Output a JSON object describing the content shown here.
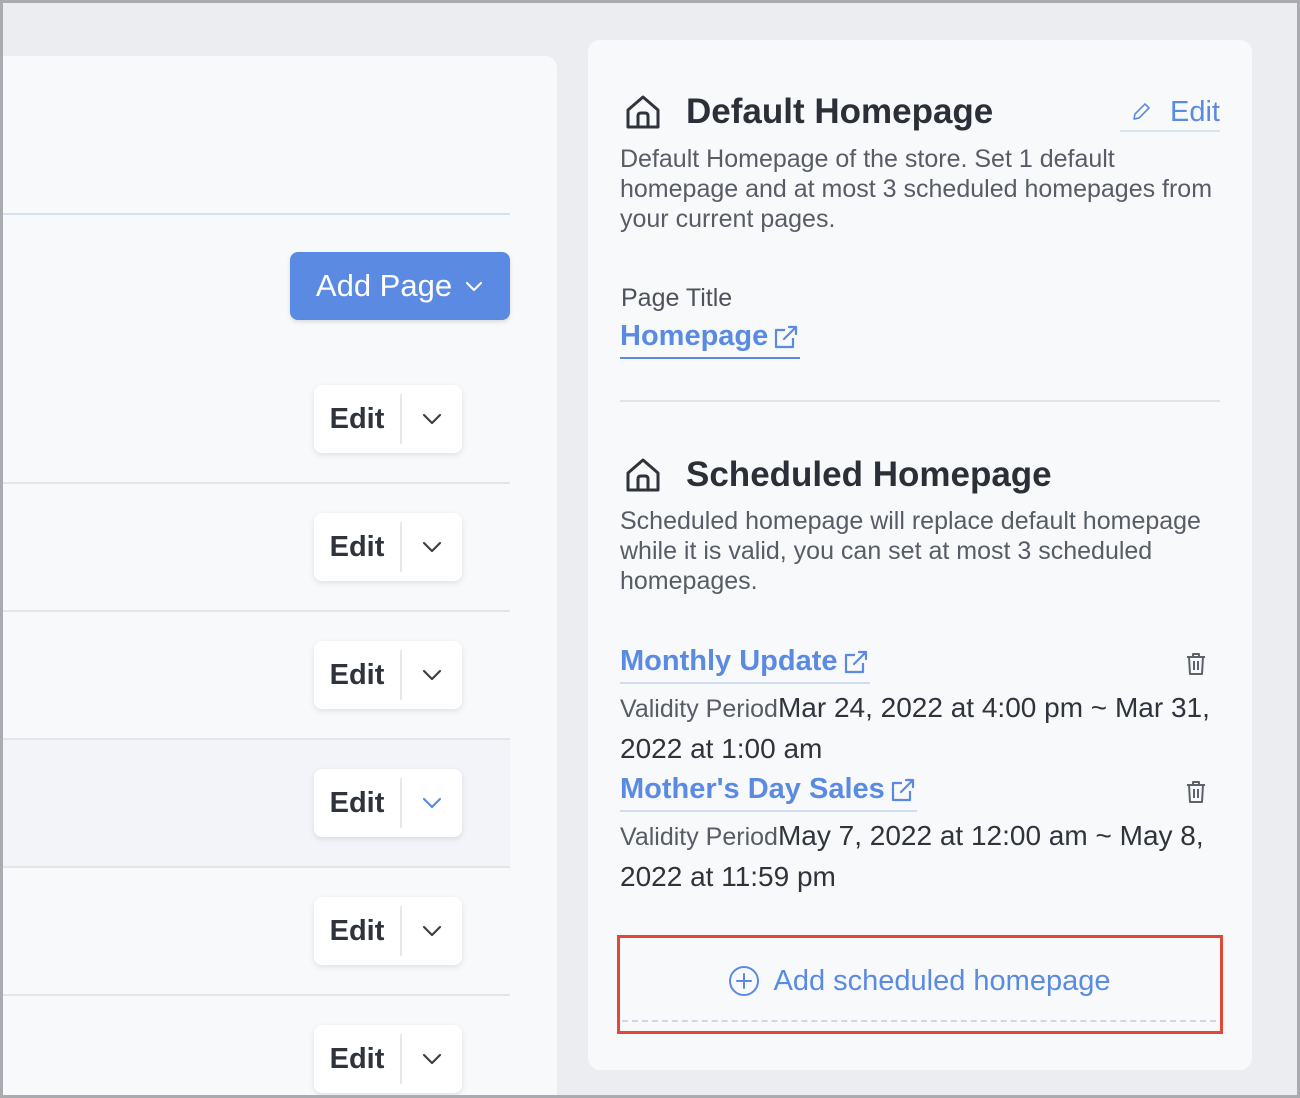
{
  "left": {
    "add_page_label": "Add Page",
    "rows": [
      {
        "edit_label": "Edit"
      },
      {
        "edit_label": "Edit"
      },
      {
        "edit_label": "Edit"
      },
      {
        "edit_label": "Edit"
      },
      {
        "edit_label": "Edit"
      },
      {
        "edit_label": "Edit"
      }
    ]
  },
  "default_homepage": {
    "title": "Default Homepage",
    "edit_label": "Edit",
    "description": "Default Homepage of the store. Set 1 default homepage and at most 3 scheduled homepages from your current pages.",
    "page_title_label": "Page Title",
    "page_link": "Homepage"
  },
  "scheduled_homepage": {
    "title": "Scheduled Homepage",
    "description": "Scheduled homepage will replace default homepage while it is valid, you can set at most 3 scheduled homepages.",
    "items": [
      {
        "name": "Monthly Update",
        "validity_label": "Validity Period",
        "validity_value": "Mar 24, 2022 at 4:00 pm ~ Mar 31, 2022 at 1:00 am"
      },
      {
        "name": "Mother's Day Sales",
        "validity_label": "Validity Period",
        "validity_value": "May 7, 2022 at 12:00 am ~ May 8, 2022 at 11:59 pm"
      }
    ],
    "add_label": "Add scheduled homepage"
  },
  "colors": {
    "accent": "#5b8ae3",
    "highlight": "#e14836"
  },
  "icons": [
    "chevron-down-icon",
    "home-icon",
    "pencil-icon",
    "external-link-icon",
    "trash-icon",
    "plus-circle-icon"
  ]
}
